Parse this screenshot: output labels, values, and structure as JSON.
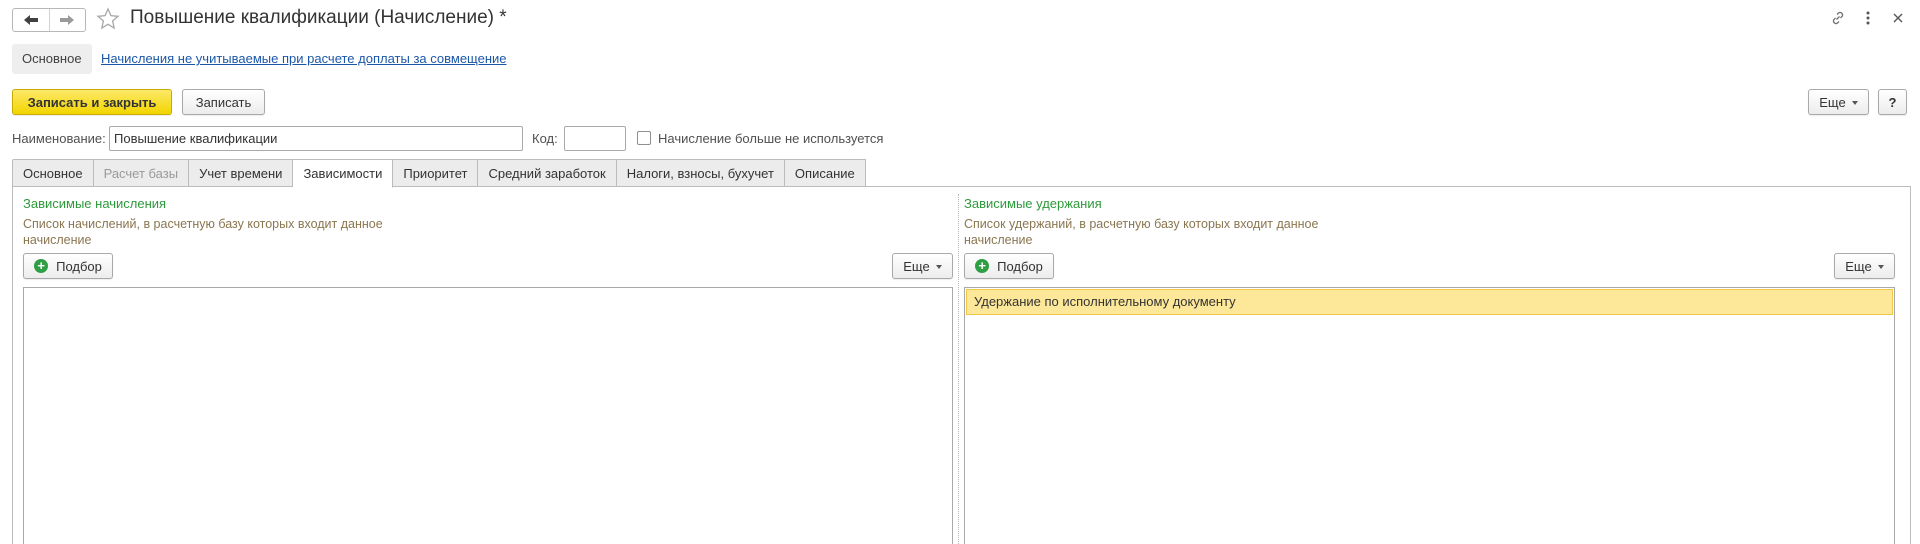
{
  "window": {
    "title": "Повышение квалификации (Начисление) *",
    "back_icon": "arrow-left-icon",
    "forward_icon": "arrow-right-icon",
    "favorite_icon": "star-icon",
    "link_icon": "link-icon",
    "more_icon": "more-vertical-icon",
    "close_icon": "close-icon"
  },
  "sections": {
    "main_label": "Основное",
    "link_label": "Начисления не учитываемые при расчете доплаты за совмещение"
  },
  "commandbar": {
    "save_close_label": "Записать и закрыть",
    "save_label": "Записать",
    "more_label": "Еще",
    "help_label": "?"
  },
  "form": {
    "name_label": "Наименование:",
    "name_value": "Повышение квалификации",
    "code_label": "Код:",
    "code_value": "",
    "not_used_label": "Начисление больше не используется",
    "not_used_checked": false
  },
  "tabs": [
    {
      "label": "Основное",
      "state": "normal"
    },
    {
      "label": "Расчет базы",
      "state": "disabled"
    },
    {
      "label": "Учет времени",
      "state": "normal"
    },
    {
      "label": "Зависимости",
      "state": "active"
    },
    {
      "label": "Приоритет",
      "state": "normal"
    },
    {
      "label": "Средний заработок",
      "state": "normal"
    },
    {
      "label": "Налоги, взносы, бухучет",
      "state": "normal"
    },
    {
      "label": "Описание",
      "state": "normal"
    }
  ],
  "dependencies": {
    "left": {
      "title": "Зависимые начисления",
      "hint": "Список начислений, в расчетную базу которых входит данное начисление",
      "pick_label": "Подбор",
      "more_label": "Еще",
      "items": []
    },
    "right": {
      "title": "Зависимые удержания",
      "hint": "Список удержаний, в расчетную базу которых входит данное начисление",
      "pick_label": "Подбор",
      "more_label": "Еще",
      "items": [
        "Удержание по исполнительному документу"
      ]
    }
  },
  "colors": {
    "accent_yellow": "#f2d500",
    "section_title_green": "#2d9a3a",
    "hint_brown": "#8a7650",
    "link_blue": "#1b57a8",
    "selected_row": "#fde89a"
  }
}
